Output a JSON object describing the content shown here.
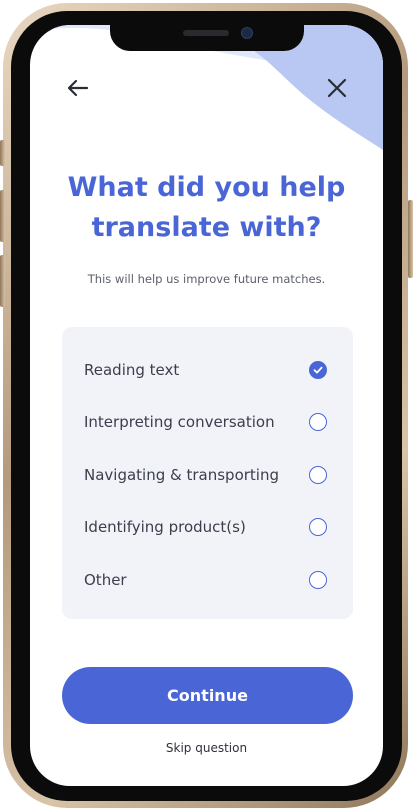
{
  "header": {
    "back_icon": "arrow-left-icon",
    "close_icon": "close-icon"
  },
  "title": "What did you help translate with?",
  "subtitle": "This will help us improve future matches.",
  "options": [
    {
      "label": "Reading text",
      "selected": true
    },
    {
      "label": "Interpreting conversation",
      "selected": false
    },
    {
      "label": "Navigating & transporting",
      "selected": false
    },
    {
      "label": "Identifying product(s)",
      "selected": false
    },
    {
      "label": "Other",
      "selected": false
    }
  ],
  "actions": {
    "continue_label": "Continue",
    "skip_label": "Skip question"
  },
  "colors": {
    "accent": "#4a66d6",
    "card_background": "#f2f3f9",
    "wave_light": "#dfe7fb",
    "wave_mid": "#b9c8f3"
  }
}
